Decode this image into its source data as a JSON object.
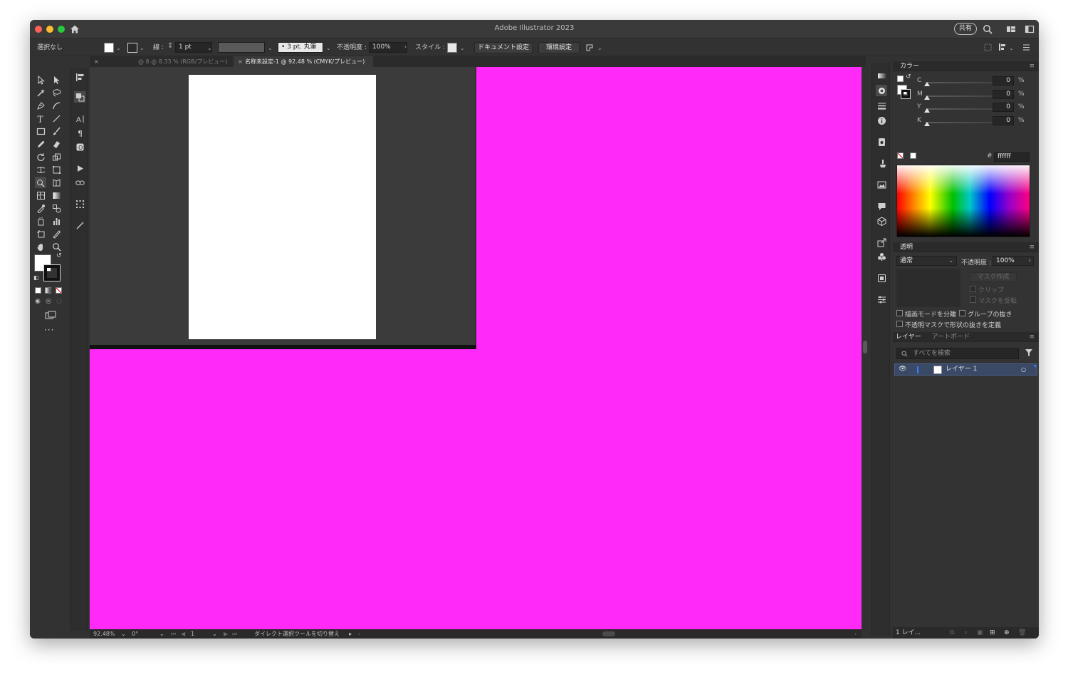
{
  "window": {
    "title": "Adobe Illustrator 2023",
    "share_label": "共有"
  },
  "control_bar": {
    "selection": "選択なし",
    "stroke_label": "線 :",
    "stroke_value": "1 pt",
    "brush_value": "3 pt. 丸筆",
    "opacity_label": "不透明度 :",
    "opacity_value": "100%",
    "style_label": "スタイル :",
    "doc_setup_button": "ドキュメント設定",
    "preferences_button": "環境設定"
  },
  "tabs": [
    {
      "label": "@ 8 @ 8.33 % (RGB/プレビュー)",
      "active": false
    },
    {
      "label": "名称未設定-1 @ 92.48 % (CMYK/プレビュー)",
      "active": true
    }
  ],
  "canvas": {
    "background_color": "#ff2af8",
    "artboard_color": "#ffffff"
  },
  "status_bar": {
    "zoom": "92.48%",
    "rotation": "0°",
    "artboard_number": "1",
    "tool_hint": "ダイレクト選択ツールを切り替え"
  },
  "color_panel": {
    "title": "カラー",
    "channels": [
      {
        "label": "C",
        "value": "0",
        "unit": "%"
      },
      {
        "label": "M",
        "value": "0",
        "unit": "%"
      },
      {
        "label": "Y",
        "value": "0",
        "unit": "%"
      },
      {
        "label": "K",
        "value": "0",
        "unit": "%"
      }
    ],
    "hex_label": "#",
    "hex_value": "ffffff"
  },
  "transparency_panel": {
    "title": "透明",
    "blend_mode": "通常",
    "opacity_label": "不透明度 :",
    "opacity_value": "100%",
    "make_mask_button": "マスク作成",
    "clip_label": "クリップ",
    "invert_mask_label": "マスクを反転",
    "isolate_blending_label": "描画モードを分離",
    "knockout_group_label": "グループの抜き",
    "opacity_mask_label": "不透明マスクで形状の抜きを定義"
  },
  "layers_panel": {
    "tab_layers": "レイヤー",
    "tab_artboards": "アートボード",
    "search_placeholder": "すべてを検索",
    "layers": [
      {
        "name": "レイヤー 1"
      }
    ],
    "footer_label": "1 レイ..."
  }
}
